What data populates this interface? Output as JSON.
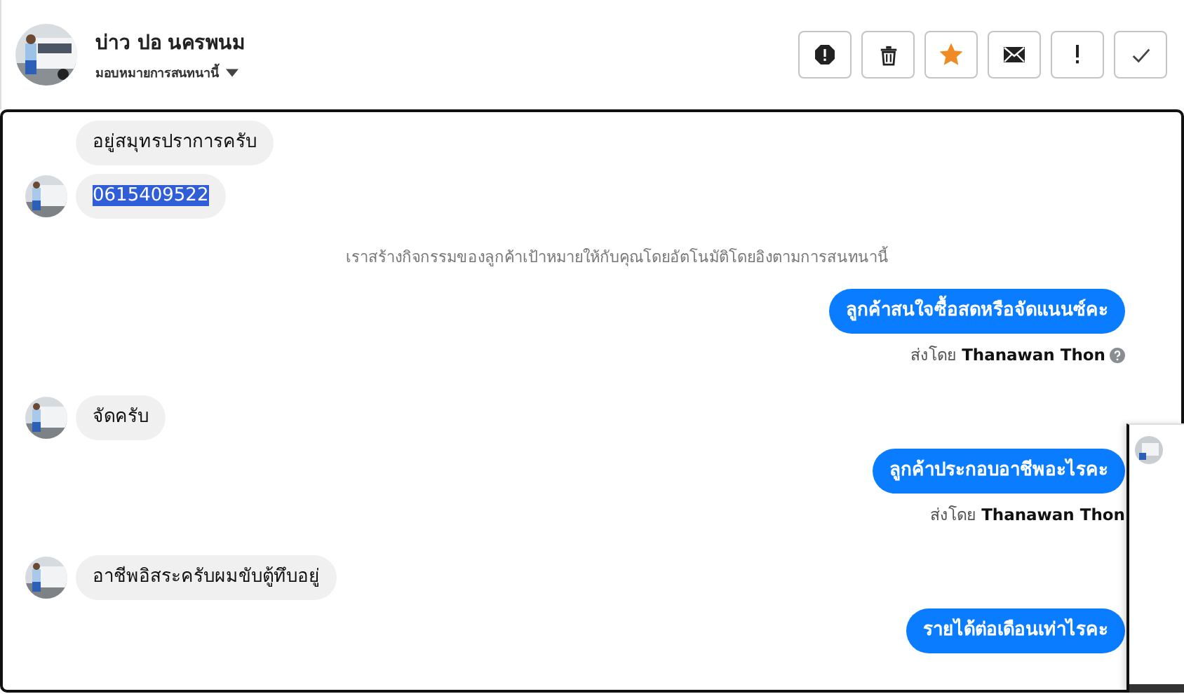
{
  "header": {
    "name": "บ่าว ปอ นครพนม",
    "assign": "มอบหมายการสนทนานี้",
    "actions": [
      {
        "kind": "report"
      },
      {
        "kind": "delete"
      },
      {
        "kind": "star",
        "on": true
      },
      {
        "kind": "mail"
      },
      {
        "kind": "important"
      },
      {
        "kind": "done"
      }
    ]
  },
  "messages": [
    {
      "kind": "incoming",
      "text": "อยู่สมุทรปราการครับ",
      "avatar": false,
      "highlighted": false
    },
    {
      "kind": "incoming",
      "text": "0615409522",
      "avatar": true,
      "highlighted": true
    },
    {
      "kind": "system",
      "text": "เราสร้างกิจกรรมของลูกค้าเป้าหมายให้กับคุณโดยอัตโนมัติโดยอิงตามการสนทนานี้"
    },
    {
      "kind": "outgoing",
      "text": "ลูกค้าสนใจซื้อสดหรือจัดแนนซ์คะ",
      "sent_by": "ส่งโดย **Thanawan Thon**",
      "help": true
    },
    {
      "kind": "incoming",
      "text": "จัดครับ",
      "avatar": true,
      "highlighted": false
    },
    {
      "kind": "outgoing",
      "text": "ลูกค้าประกอบอาชีพอะไรคะ",
      "sent_by": "ส่งโดย **Thanawan Thon**",
      "help": false
    },
    {
      "kind": "incoming",
      "text": "อาชีพอิสระครับผมขับตู้ทึบอยู่",
      "avatar": true,
      "highlighted": false
    },
    {
      "kind": "outgoing",
      "text": "รายได้ต่อเดือนเท่าไรคะ"
    }
  ]
}
